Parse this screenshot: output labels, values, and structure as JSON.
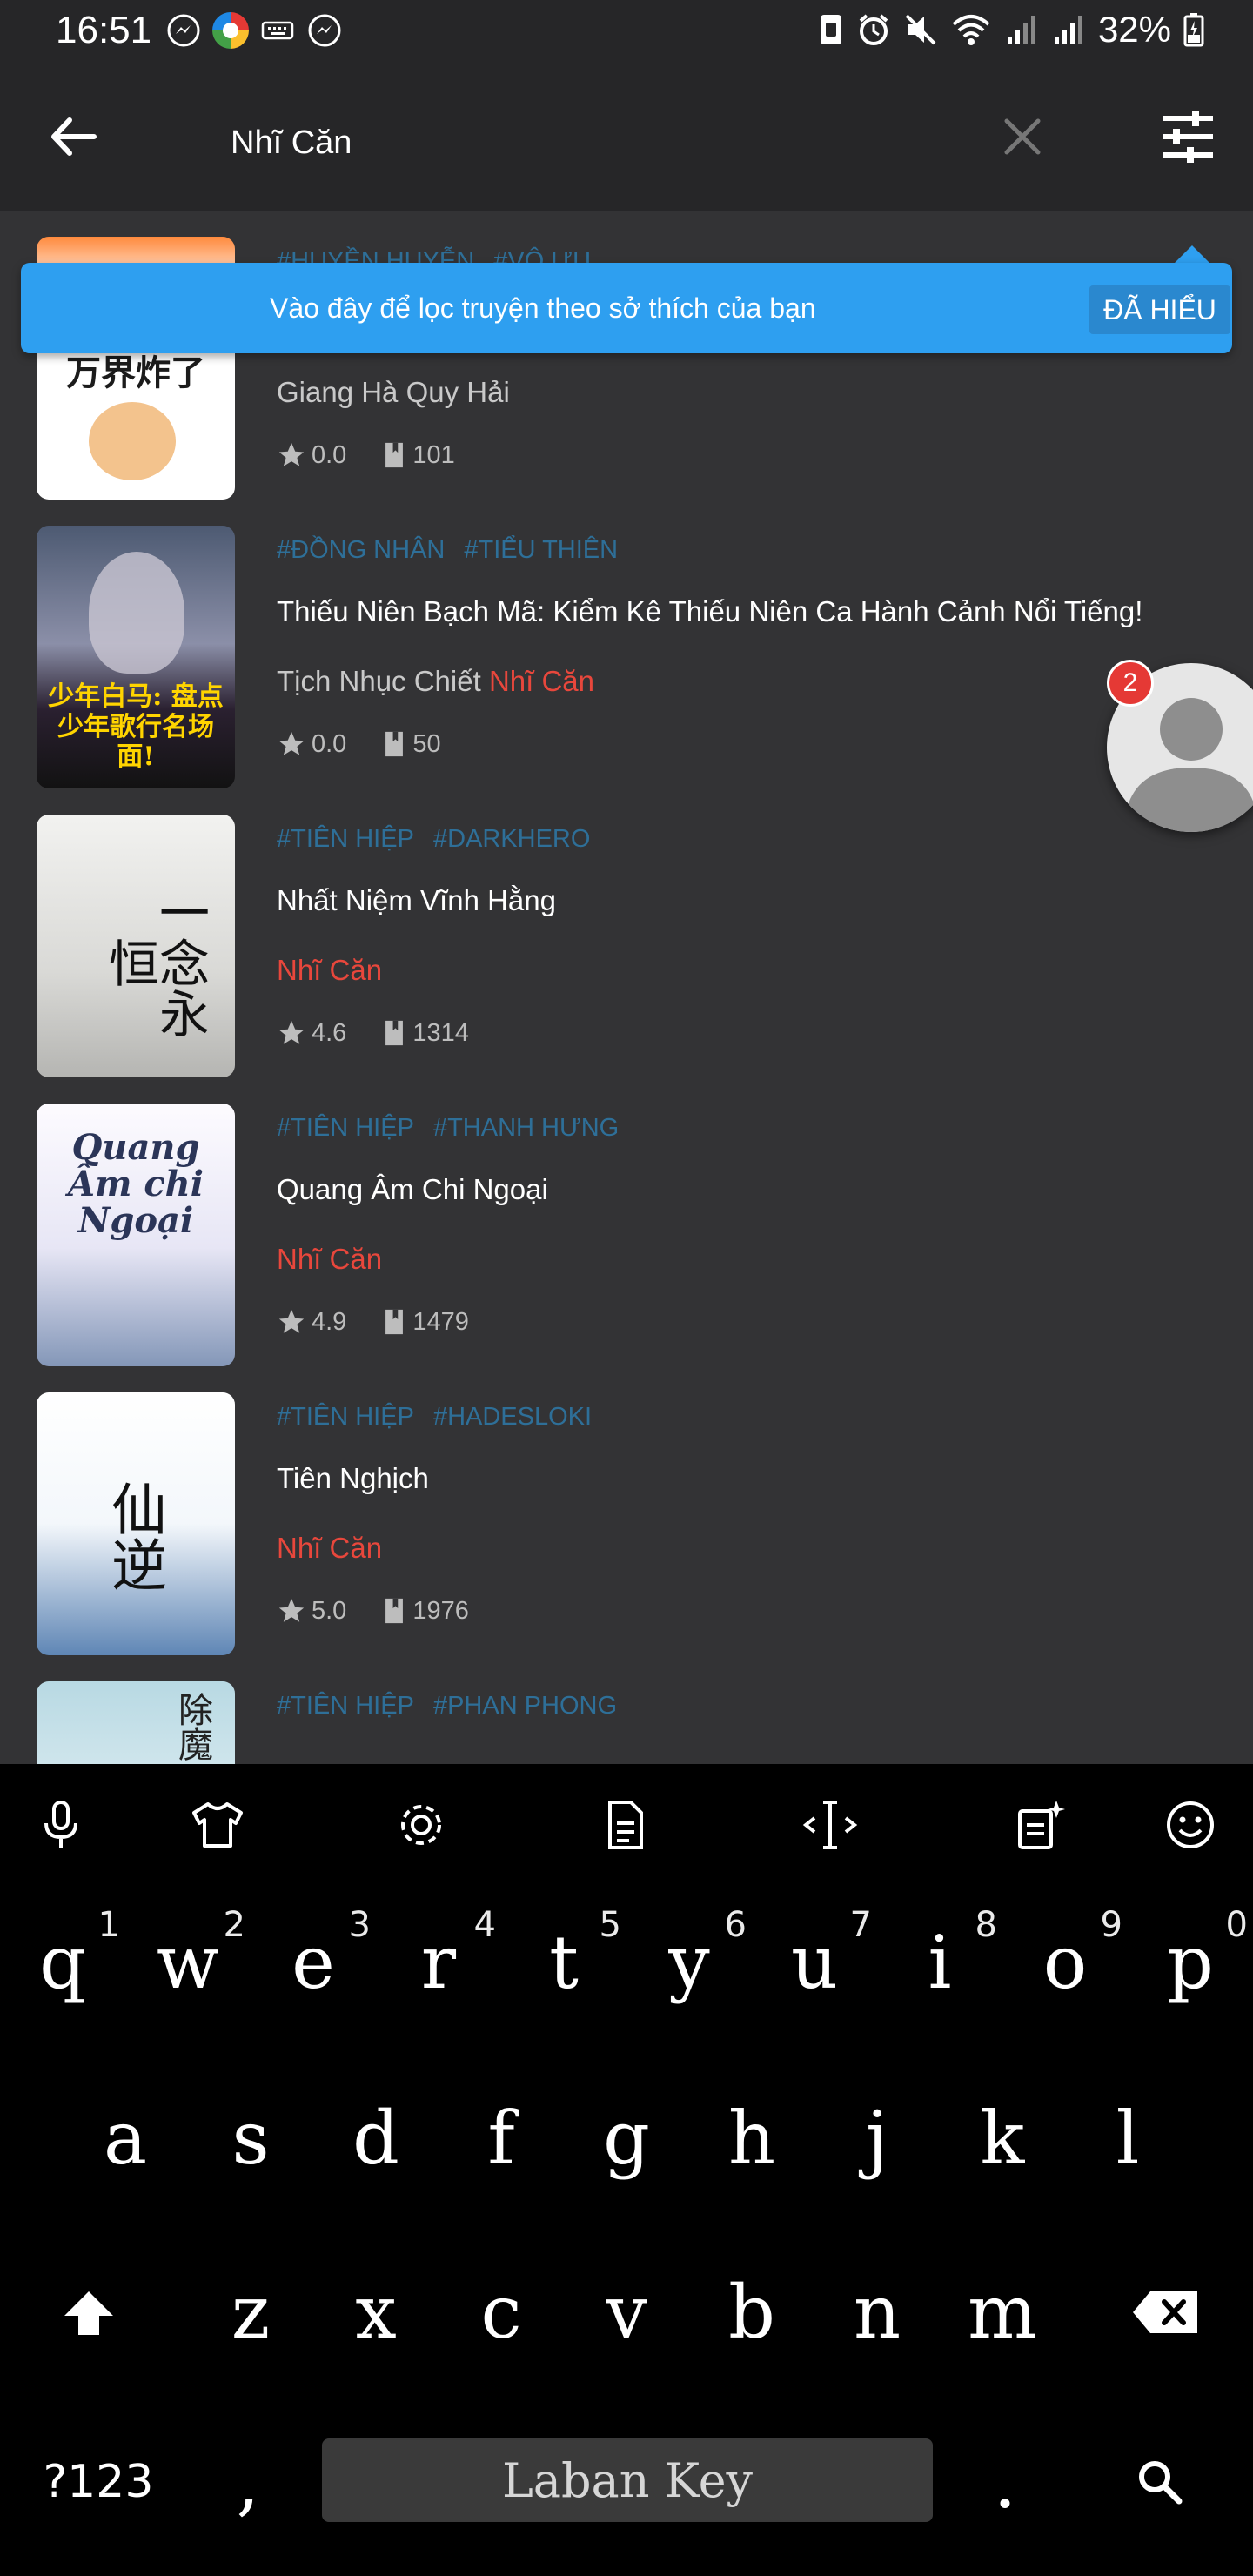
{
  "status": {
    "time": "16:51",
    "battery": "32%"
  },
  "search": {
    "query": "Nhĩ Căn"
  },
  "tooltip": {
    "text": "Vào đây để lọc truyện theo sở thích của bạn",
    "button": "ĐÃ HIỂU"
  },
  "badge_count": "2",
  "items": [
    {
      "tags": [
        "#HUYỀN HUYỄN",
        "#VÔ ƯU"
      ],
      "title": "",
      "author_plain": "Giang Hà Quy Hải",
      "author_highlight": "",
      "rating": "0.0",
      "chapters": "101",
      "cover_text": "万界炸了"
    },
    {
      "tags": [
        "#ĐỒNG NHÂN",
        "#TIỂU THIÊN"
      ],
      "title": "Thiếu Niên Bạch Mã: Kiểm Kê Thiếu Niên Ca Hành Cảnh Nổi Tiếng!",
      "author_plain": "Tịch Nhục Chiết ",
      "author_highlight": "Nhĩ Căn",
      "rating": "0.0",
      "chapters": "50",
      "cover_text": "少年白马: 盘点少年歌行名场面!"
    },
    {
      "tags": [
        "#TIÊN HIỆP",
        "#DARKHERO"
      ],
      "title": "Nhất Niệm Vĩnh Hằng",
      "author_plain": "",
      "author_highlight": "Nhĩ Căn",
      "rating": "4.6",
      "chapters": "1314",
      "cover_text": "一念永恒"
    },
    {
      "tags": [
        "#TIÊN HIỆP",
        "#THANH HƯNG"
      ],
      "title": "Quang Âm Chi Ngoại",
      "author_plain": "",
      "author_highlight": "Nhĩ Căn",
      "rating": "4.9",
      "chapters": "1479",
      "cover_text": "Quang Âm chi Ngoại"
    },
    {
      "tags": [
        "#TIÊN HIỆP",
        "#HADESLOKI"
      ],
      "title": "Tiên Nghịch",
      "author_plain": "",
      "author_highlight": "Nhĩ Căn",
      "rating": "5.0",
      "chapters": "1976",
      "cover_text": "仙逆"
    },
    {
      "tags": [
        "#TIÊN HIỆP",
        "#PHAN PHONG"
      ],
      "title": "",
      "author_plain": "",
      "author_highlight": "",
      "rating": "",
      "chapters": "",
      "cover_text": "除魔"
    }
  ],
  "keyboard": {
    "row1": [
      {
        "ch": "q",
        "num": "1"
      },
      {
        "ch": "w",
        "num": "2"
      },
      {
        "ch": "e",
        "num": "3"
      },
      {
        "ch": "r",
        "num": "4"
      },
      {
        "ch": "t",
        "num": "5"
      },
      {
        "ch": "y",
        "num": "6"
      },
      {
        "ch": "u",
        "num": "7"
      },
      {
        "ch": "i",
        "num": "8"
      },
      {
        "ch": "o",
        "num": "9"
      },
      {
        "ch": "p",
        "num": "0"
      }
    ],
    "row2": [
      "a",
      "s",
      "d",
      "f",
      "g",
      "h",
      "j",
      "k",
      "l"
    ],
    "row3": [
      "z",
      "x",
      "c",
      "v",
      "b",
      "n",
      "m"
    ],
    "symbols_key": "?123",
    "comma": ",",
    "period": ".",
    "space_label": "Laban Key"
  },
  "colors": {
    "accent_blue": "#2e9ff0",
    "tag_blue": "#2e6f98",
    "highlight_red": "#e8473c",
    "background": "#333335",
    "appbar": "#262628"
  }
}
